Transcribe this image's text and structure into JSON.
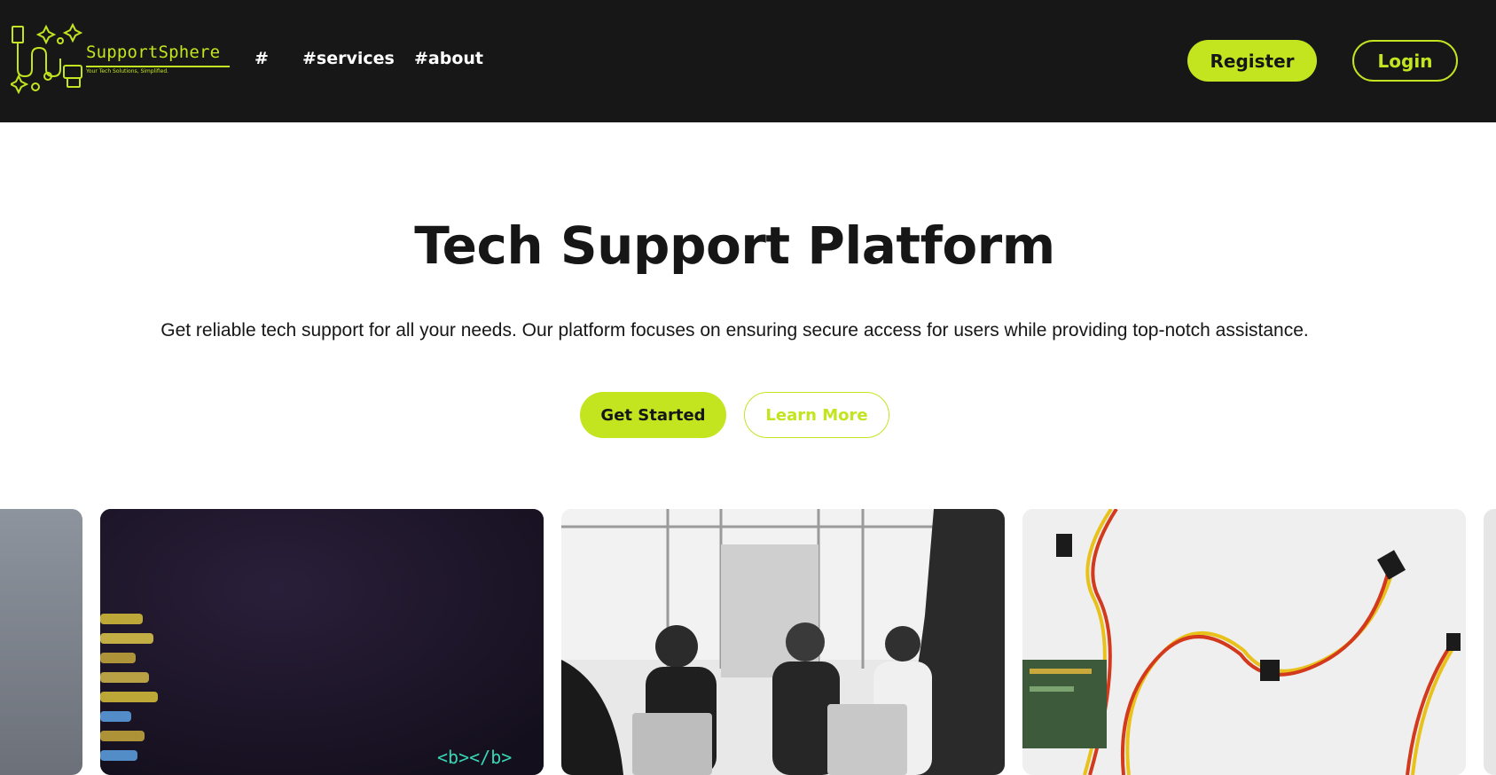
{
  "brand": {
    "name": "SupportSphere",
    "tagline": "Your Tech Solutions, Simplified.",
    "accent_color": "#c2e51f",
    "nav_background": "#171717"
  },
  "nav": {
    "links": [
      "#",
      "#services",
      "#about"
    ],
    "register_label": "Register",
    "login_label": "Login"
  },
  "hero": {
    "title": "Tech Support Platform",
    "subtitle": "Get reliable tech support for all your needs. Our platform focuses on ensuring secure access for users while providing top-notch assistance.",
    "primary_button": "Get Started",
    "secondary_button": "Learn More"
  },
  "gallery": {
    "images": [
      {
        "name": "grey-abstract-image"
      },
      {
        "name": "code-on-screen-image",
        "visible_code_text": "<b></b>"
      },
      {
        "name": "team-meeting-image"
      },
      {
        "name": "colored-wires-image"
      },
      {
        "name": "partial-image"
      }
    ]
  }
}
